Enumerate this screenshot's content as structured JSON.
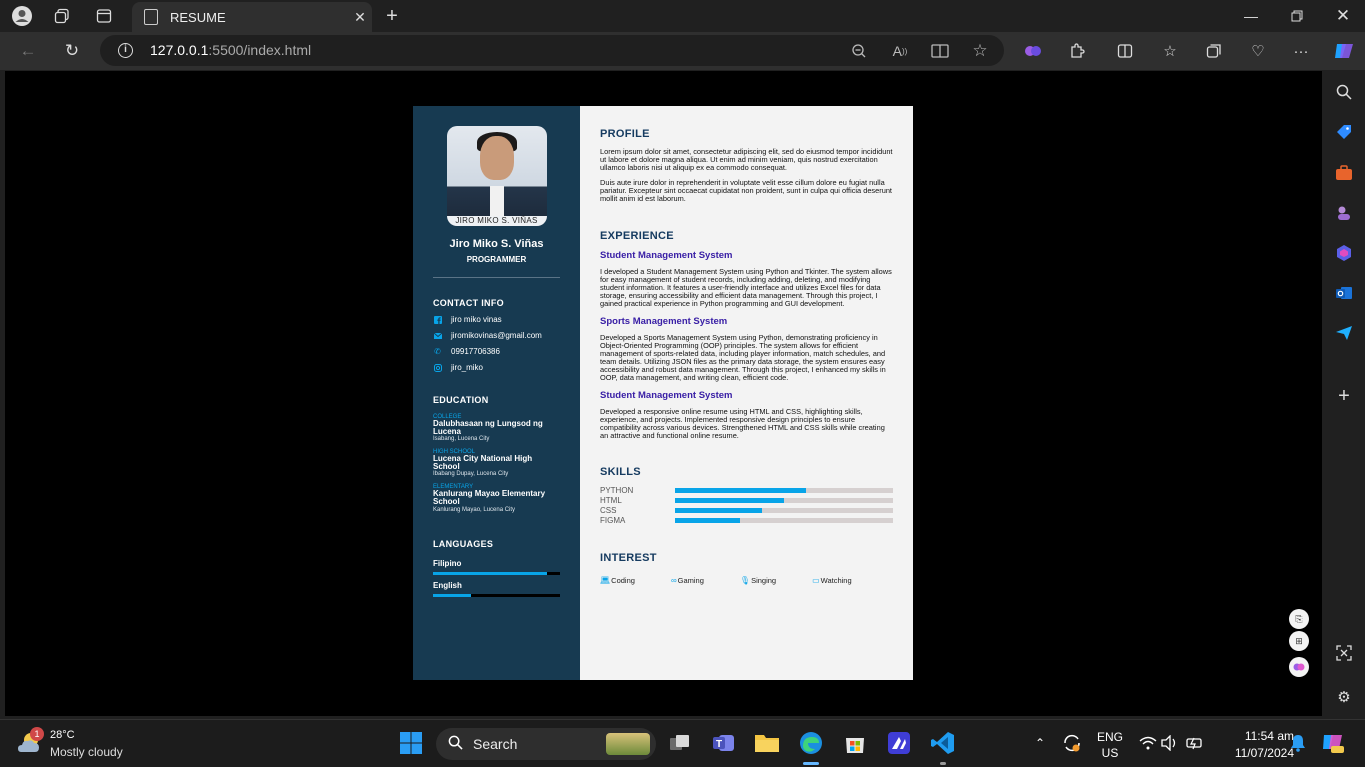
{
  "browser": {
    "tab_title": "RESUME",
    "url_host": "127.0.0.1",
    "url_path": ":5500/index.html"
  },
  "resume": {
    "photo_caption": "JIRO MIKO S. VIÑAS",
    "name": "Jiro Miko S. Viñas",
    "role": "PROGRAMMER",
    "contact": {
      "title": "CONTACT INFO",
      "items": [
        {
          "icon": "facebook-icon",
          "text": "jiro miko vinas"
        },
        {
          "icon": "email-icon",
          "text": "jiromikovinas@gmail.com"
        },
        {
          "icon": "phone-icon",
          "text": "09917706386"
        },
        {
          "icon": "instagram-icon",
          "text": "jiro_miko"
        }
      ]
    },
    "education": {
      "title": "EDUCATION",
      "items": [
        {
          "level": "COLLEGE",
          "school": "Dalubhasaan ng Lungsod ng Lucena",
          "place": "Isabang, Lucena City"
        },
        {
          "level": "HIGH SCHOOL",
          "school": "Lucena City National High School",
          "place": "Ibabang Dupay, Lucena City"
        },
        {
          "level": "ELEMENTARY",
          "school": "Kanlurang Mayao Elementary School",
          "place": "Kanlurang Mayao, Lucena City"
        }
      ]
    },
    "languages": {
      "title": "LANGUAGES",
      "items": [
        {
          "name": "Filipino",
          "level": 0.9
        },
        {
          "name": "English",
          "level": 0.3
        }
      ]
    },
    "profile": {
      "title": "PROFILE",
      "p1": "Lorem ipsum dolor sit amet, consectetur adipiscing elit, sed do eiusmod tempor incididunt ut labore et dolore magna aliqua. Ut enim ad minim veniam, quis nostrud exercitation ullamco laboris nisi ut aliquip ex ea commodo consequat.",
      "p2": "Duis aute irure dolor in reprehenderit in voluptate velit esse cillum dolore eu fugiat nulla pariatur. Excepteur sint occaecat cupidatat non proident, sunt in culpa qui officia deserunt mollit anim id est laborum."
    },
    "experience": {
      "title": "EXPERIENCE",
      "items": [
        {
          "title": "Student Management System",
          "desc": "I developed a Student Management System using Python and Tkinter. The system allows for easy management of student records, including adding, deleting, and modifying student information. It features a user-friendly interface and utilizes Excel files for data storage, ensuring accessibility and efficient data management. Through this project, I gained practical experience in Python programming and GUI development."
        },
        {
          "title": "Sports Management System",
          "desc": "Developed a Sports Management System using Python, demonstrating proficiency in Object-Oriented Programming (OOP) principles. The system allows for efficient management of sports-related data, including player information, match schedules, and team details. Utilizing JSON files as the primary data storage, the system ensures easy accessibility and robust data management. Through this project, I enhanced my skills in OOP, data management, and writing clean, efficient code."
        },
        {
          "title": "Student Management System",
          "desc": "Developed a responsive online resume using HTML and CSS, highlighting skills, experience, and projects. Implemented responsive design principles to ensure compatibility across various devices. Strengthened HTML and CSS skills while creating an attractive and functional online resume."
        }
      ]
    },
    "skills": {
      "title": "SKILLS",
      "items": [
        {
          "name": "PYTHON",
          "level": 0.6
        },
        {
          "name": "HTML",
          "level": 0.5
        },
        {
          "name": "CSS",
          "level": 0.4
        },
        {
          "name": "FIGMA",
          "level": 0.3
        }
      ]
    },
    "interest": {
      "title": "INTEREST",
      "items": [
        {
          "icon": "laptop-icon",
          "label": "Coding"
        },
        {
          "icon": "gamepad-icon",
          "label": "Gaming"
        },
        {
          "icon": "microphone-icon",
          "label": "Singing"
        },
        {
          "icon": "monitor-icon",
          "label": "Watching"
        }
      ]
    }
  },
  "taskbar": {
    "weather_badge": "1",
    "temperature": "28°C",
    "weather": "Mostly cloudy",
    "search_label": "Search",
    "lang_top": "ENG",
    "lang_bottom": "US",
    "time": "11:54 am",
    "date": "11/07/2024"
  },
  "colors": {
    "sidebar_bg": "#173a51",
    "accent": "#08a4e8",
    "heading": "#163b60",
    "project_title": "#3a20a6"
  }
}
